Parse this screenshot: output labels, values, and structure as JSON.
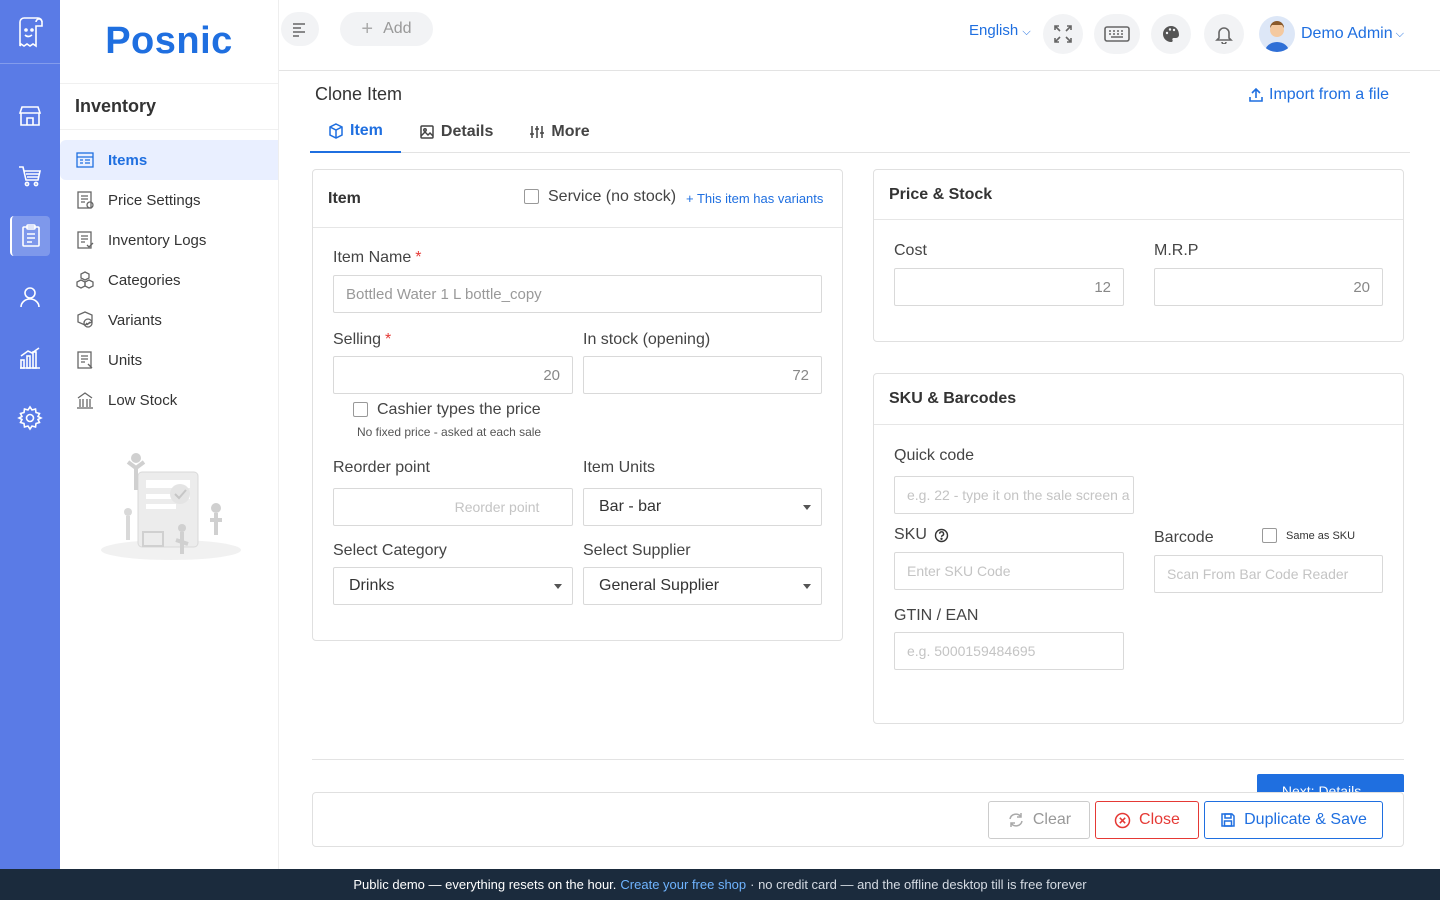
{
  "app": {
    "brand": "Posnic"
  },
  "rail": {
    "items": [
      "store-icon",
      "cart-icon",
      "clipboard-icon",
      "user-icon",
      "chart-icon",
      "gear-icon"
    ],
    "active_index": 2
  },
  "sidebar": {
    "section": "Inventory",
    "items": [
      {
        "label": "Items",
        "icon": "items-icon",
        "active": true
      },
      {
        "label": "Price Settings",
        "icon": "price-icon"
      },
      {
        "label": "Inventory Logs",
        "icon": "logs-icon"
      },
      {
        "label": "Categories",
        "icon": "cubes-icon"
      },
      {
        "label": "Variants",
        "icon": "variants-icon"
      },
      {
        "label": "Units",
        "icon": "units-icon"
      },
      {
        "label": "Low Stock",
        "icon": "low-stock-icon"
      }
    ]
  },
  "topbar": {
    "add_label": "Add",
    "language": "English",
    "user_name": "Demo Admin"
  },
  "page": {
    "title": "Clone Item",
    "import_label": "Import from a file"
  },
  "tabs": [
    {
      "label": "Item",
      "active": true
    },
    {
      "label": "Details"
    },
    {
      "label": "More"
    }
  ],
  "item_card": {
    "title": "Item",
    "service_label": "Service (no stock)",
    "variants_link": "+ This item has variants",
    "item_name_label": "Item Name",
    "item_name_value": "Bottled Water 1 L bottle_copy",
    "selling_label": "Selling",
    "selling_value": "20",
    "stock_label": "In stock (opening)",
    "stock_value": "72",
    "cashier_label": "Cashier types the price",
    "cashier_hint": "No fixed price - asked at each sale",
    "reorder_label": "Reorder point",
    "reorder_placeholder": "Reorder point",
    "units_label": "Item Units",
    "units_value": "Bar - bar",
    "category_label": "Select Category",
    "category_value": "Drinks",
    "supplier_label": "Select Supplier",
    "supplier_value": "General Supplier"
  },
  "price_card": {
    "title": "Price & Stock",
    "cost_label": "Cost",
    "cost_value": "12",
    "mrp_label": "M.R.P",
    "mrp_value": "20"
  },
  "sku_card": {
    "title": "SKU & Barcodes",
    "quick_label": "Quick code",
    "quick_placeholder": "e.g. 22 - type it on the sale screen a",
    "sku_label": "SKU",
    "sku_placeholder": "Enter SKU Code",
    "barcode_label": "Barcode",
    "same_as_sku": "Same as SKU",
    "barcode_placeholder": "Scan From Bar Code Reader",
    "gtin_label": "GTIN / EAN",
    "gtin_placeholder": "e.g. 5000159484695"
  },
  "actions": {
    "next_label": "Next: Details →",
    "clear_label": "Clear",
    "close_label": "Close",
    "save_label": "Duplicate & Save"
  },
  "demo_bar": {
    "text1": "Public demo — everything resets on the hour.",
    "link": "Create your free shop",
    "text2": "· no credit card — and the offline desktop till is free forever"
  },
  "colors": {
    "accent": "#1f6fe0",
    "rail": "#5a7be6",
    "danger": "#e53935",
    "footer": "#1b2b3d"
  }
}
